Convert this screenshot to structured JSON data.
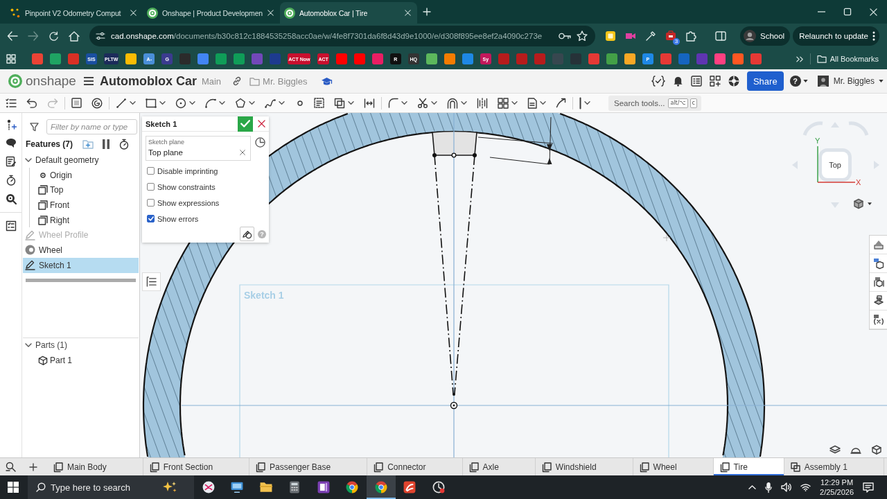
{
  "browser": {
    "tabs": [
      {
        "title": "Pinpoint V2 Odometry Comput",
        "kind": "dots",
        "selected": false
      },
      {
        "title": "Onshape | Product Developmen",
        "kind": "onshape",
        "selected": false
      },
      {
        "title": "Automoblox Car | Tire",
        "kind": "onshape",
        "selected": true
      }
    ],
    "url": {
      "host": "cad.onshape.com",
      "path": "/documents/b30c812c1884535258acc0ae/w/4fe8f7301da6f8d43d9e1000/e/d308f895ee8ef2a4090c273e"
    },
    "extension_badge": "3",
    "profile": "School",
    "relaunch_button": "Relaunch to update",
    "bookmarks": [
      {
        "color": "#ea4335"
      },
      {
        "color": "#1fa463"
      },
      {
        "color": "#d93025"
      },
      {
        "color": "#1a4fa0",
        "label": "SIS"
      },
      {
        "color": "#1c2b5a",
        "label": "PLTW"
      },
      {
        "color": "#fbbc04"
      },
      {
        "color": "#4a8fd8",
        "label": "A-"
      },
      {
        "color": "#3b3b8f",
        "label": "G"
      },
      {
        "color": "#2b2b2b"
      },
      {
        "color": "#4285f4"
      },
      {
        "color": "#0f9d58"
      },
      {
        "color": "#0f9d58"
      },
      {
        "color": "#7248b9"
      },
      {
        "color": "#1d3b8f"
      },
      {
        "color": "#c8102e",
        "label": "ACT Now"
      },
      {
        "color": "#c8102e",
        "label": "ACT"
      },
      {
        "color": "#ff0000"
      },
      {
        "color": "#ff0000"
      },
      {
        "color": "#e91e63"
      },
      {
        "color": "#111111",
        "label": "R"
      },
      {
        "color": "#333333",
        "label": "HQ"
      },
      {
        "color": "#5cb85c"
      },
      {
        "color": "#f57c00"
      },
      {
        "color": "#1e88e5"
      },
      {
        "color": "#c2185b",
        "label": "Sy"
      },
      {
        "color": "#b71c1c"
      },
      {
        "color": "#b71c1c"
      },
      {
        "color": "#b71c1c"
      },
      {
        "color": "#37474f"
      },
      {
        "color": "#263238"
      },
      {
        "color": "#e53935"
      },
      {
        "color": "#43a047"
      },
      {
        "color": "#f9a825"
      },
      {
        "color": "#1e88e5",
        "label": "P"
      },
      {
        "color": "#e53935"
      },
      {
        "color": "#1565c0"
      },
      {
        "color": "#5e35b1"
      },
      {
        "color": "#ff4081"
      },
      {
        "color": "#ff5722"
      },
      {
        "color": "#e53935"
      }
    ],
    "all_bookmarks": "All Bookmarks"
  },
  "header": {
    "logo_text": "onshape",
    "document_title": "Automoblox Car",
    "branch": "Main",
    "owner": "Mr. Biggles",
    "share_button": "Share",
    "help": "?",
    "user_name": "Mr. Biggles"
  },
  "toolbar": {
    "search": {
      "placeholder": "Search tools...",
      "keys": [
        "alt/⌥",
        "c"
      ]
    }
  },
  "feature_panel": {
    "filter": {
      "placeholder": "Filter by name or type"
    },
    "title": "Features (7)",
    "items": [
      {
        "label": "Default geometry",
        "kind": "folder",
        "expanded": true,
        "selected": false,
        "disabled": false,
        "children": [
          {
            "label": "Origin",
            "kind": "origin",
            "selected": false,
            "disabled": false
          },
          {
            "label": "Top",
            "kind": "plane",
            "selected": false,
            "disabled": false
          },
          {
            "label": "Front",
            "kind": "plane",
            "selected": false,
            "disabled": false
          },
          {
            "label": "Right",
            "kind": "plane",
            "selected": false,
            "disabled": false
          }
        ]
      },
      {
        "label": "Wheel Profile",
        "kind": "sketch",
        "selected": false,
        "disabled": true
      },
      {
        "label": "Wheel",
        "kind": "revolve",
        "selected": false,
        "disabled": false
      },
      {
        "label": "Sketch 1",
        "kind": "sketch",
        "selected": true,
        "disabled": false
      }
    ],
    "parts": {
      "title": "Parts (1)",
      "expanded": true,
      "items": [
        {
          "label": "Part 1",
          "kind": "part",
          "selected": false
        }
      ]
    }
  },
  "sketch_dialog": {
    "title": "Sketch 1",
    "plane_label": "Sketch plane",
    "plane_value": "Top plane",
    "options": [
      {
        "label": "Disable imprinting",
        "checked": false
      },
      {
        "label": "Show constraints",
        "checked": false
      },
      {
        "label": "Show expressions",
        "checked": false
      },
      {
        "label": "Show errors",
        "checked": true
      }
    ],
    "help": "?"
  },
  "canvas": {
    "sketch_label": "Sketch 1",
    "view_cube": {
      "face": "Top",
      "y_axis": "Y",
      "x_axis": "X"
    }
  },
  "document_tabs": [
    {
      "label": "Main Body",
      "kind": "part_studio",
      "selected": false
    },
    {
      "label": "Front Section",
      "kind": "part_studio",
      "selected": false
    },
    {
      "label": "Passenger Base",
      "kind": "part_studio",
      "selected": false
    },
    {
      "label": "Connector",
      "kind": "part_studio",
      "selected": false
    },
    {
      "label": "Axle",
      "kind": "part_studio",
      "selected": false
    },
    {
      "label": "Windshield",
      "kind": "part_studio",
      "selected": false
    },
    {
      "label": "Wheel",
      "kind": "part_studio",
      "selected": false
    },
    {
      "label": "Tire",
      "kind": "part_studio",
      "selected": true
    },
    {
      "label": "Assembly 1",
      "kind": "assembly",
      "selected": false
    }
  ],
  "taskbar": {
    "search_placeholder": "Type here to search",
    "apps": [
      {
        "kind": "snip",
        "selected": false
      },
      {
        "kind": "screen",
        "selected": false
      },
      {
        "kind": "folder",
        "selected": false
      },
      {
        "kind": "calculator",
        "selected": false
      },
      {
        "kind": "notebook",
        "selected": false
      },
      {
        "kind": "browser",
        "selected": false
      },
      {
        "kind": "browser",
        "selected": true
      },
      {
        "kind": "rapid",
        "selected": false
      },
      {
        "kind": "timer",
        "selected": false
      }
    ],
    "time": "12:29 PM",
    "date": "2/25/2026"
  }
}
